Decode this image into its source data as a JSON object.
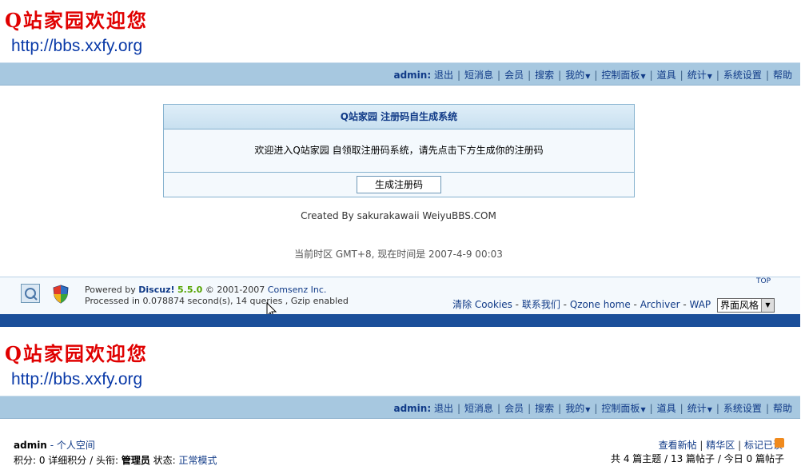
{
  "site": {
    "title": "Q站家园欢迎您",
    "url": "http://bbs.xxfy.org"
  },
  "nav": {
    "user": "admin:",
    "items": [
      {
        "label": "退出",
        "dropdown": false
      },
      {
        "label": "短消息",
        "dropdown": false
      },
      {
        "label": "会员",
        "dropdown": false
      },
      {
        "label": "搜索",
        "dropdown": false
      },
      {
        "label": "我的",
        "dropdown": true
      },
      {
        "label": "控制面板",
        "dropdown": true
      },
      {
        "label": "道具",
        "dropdown": false
      },
      {
        "label": "统计",
        "dropdown": true
      },
      {
        "label": "系统设置",
        "dropdown": false
      },
      {
        "label": "帮助",
        "dropdown": false
      }
    ]
  },
  "panel": {
    "title": "Q站家园 注册码自生成系统",
    "message": "欢迎进入Q站家园 自领取注册码系统，请先点击下方生成你的注册码",
    "button": "生成注册码"
  },
  "credit": "Created By sakurakawaii WeiyuBBS.COM",
  "timezone": "当前时区  GMT+8, 现在时间是  2007-4-9 00:03",
  "footer": {
    "powered_prefix": "Powered by ",
    "discuz": "Discuz!",
    "version": "5.5.0",
    "copyright": " © 2001-2007 ",
    "comsenz": "Comsenz Inc.",
    "processed": "Processed in 0.078874 second(s), 14 queries , Gzip enabled",
    "top": "TOP",
    "links": [
      "清除 Cookies",
      "联系我们",
      "Qzone home",
      "Archiver",
      "WAP"
    ],
    "style_select": "界面风格"
  },
  "lower": {
    "username": "admin",
    "space_link": "- 个人空间",
    "line2_prefix": "积分: 0 详细积分  / 头衔: ",
    "rank": "管理员",
    "status_prefix": " 状态: ",
    "status": "正常模式",
    "right_links": [
      "查看新帖",
      "精华区",
      "标记已读"
    ],
    "stats": "共  4 篇主题  / 13 篇帖子  / 今日  0 篇帖子"
  },
  "colors": {
    "navbar": "#a7c8e0",
    "link": "#103a87",
    "title_red": "#e00000",
    "footer_bar": "#1b4f9a"
  },
  "icons": [
    "q-logo-icon",
    "shield-icon",
    "caret-down-icon",
    "rss-icon",
    "cursor-icon"
  ]
}
